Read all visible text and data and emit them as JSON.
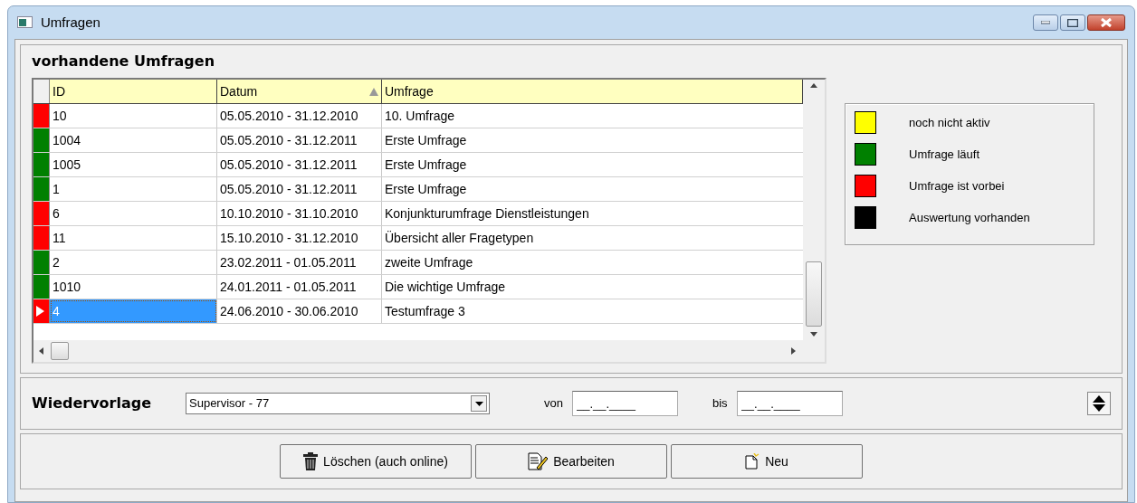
{
  "window": {
    "title": "Umfragen"
  },
  "survey_section": {
    "title": "vorhandene Umfragen"
  },
  "table": {
    "columns": [
      {
        "label": "ID",
        "sorted": false
      },
      {
        "label": "Datum",
        "sorted": true
      },
      {
        "label": "Umfrage",
        "sorted": false
      }
    ],
    "rows": [
      {
        "color": "#ff0000",
        "selected": false,
        "cells": [
          "10",
          "05.05.2010 - 31.12.2010",
          "10. Umfrage"
        ]
      },
      {
        "color": "#008000",
        "selected": false,
        "cells": [
          "1004",
          "05.05.2010 - 31.12.2011",
          "Erste Umfrage"
        ]
      },
      {
        "color": "#008000",
        "selected": false,
        "cells": [
          "1005",
          "05.05.2010 - 31.12.2011",
          "Erste Umfrage"
        ]
      },
      {
        "color": "#008000",
        "selected": false,
        "cells": [
          "1",
          "05.05.2010 - 31.12.2011",
          "Erste Umfrage"
        ]
      },
      {
        "color": "#ff0000",
        "selected": false,
        "cells": [
          "6",
          "10.10.2010 - 31.10.2010",
          "Konjunkturumfrage Dienstleistungen"
        ]
      },
      {
        "color": "#ff0000",
        "selected": false,
        "cells": [
          "11",
          "15.10.2010 - 31.12.2010",
          "Übersicht aller Fragetypen"
        ]
      },
      {
        "color": "#008000",
        "selected": false,
        "cells": [
          "2",
          "23.02.2011 - 01.05.2011",
          "zweite Umfrage"
        ]
      },
      {
        "color": "#008000",
        "selected": false,
        "cells": [
          "1010",
          "24.01.2011 - 01.05.2011",
          "Die wichtige Umfrage"
        ]
      },
      {
        "color": "#ff0000",
        "selected": true,
        "cells": [
          "4",
          "24.06.2010 - 30.06.2010",
          "Testumfrage 3"
        ]
      }
    ]
  },
  "legend": [
    {
      "color": "#ffff00",
      "label": "noch nicht aktiv"
    },
    {
      "color": "#008000",
      "label": "Umfrage läuft"
    },
    {
      "color": "#ff0000",
      "label": "Umfrage ist vorbei"
    },
    {
      "color": "#000000",
      "label": "Auswertung vorhanden"
    }
  ],
  "resubmission": {
    "label": "Wiedervorlage",
    "dropdown": "Supervisor - 77",
    "from_label": "von",
    "from_placeholder": "__.__.____",
    "to_label": "bis",
    "to_placeholder": "__.__.____"
  },
  "buttons": [
    {
      "kind": "delete",
      "label": "Löschen (auch online)"
    },
    {
      "kind": "edit",
      "label": "Bearbeiten"
    },
    {
      "kind": "new",
      "label": "Neu"
    }
  ]
}
